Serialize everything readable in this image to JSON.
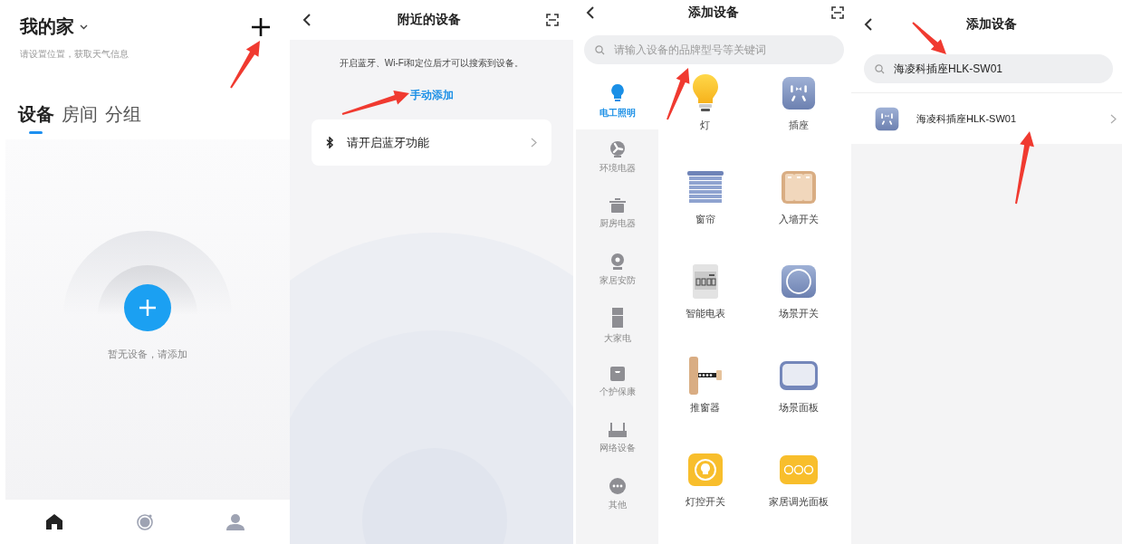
{
  "home": {
    "title": "我的家",
    "subtitle": "请设置位置，获取天气信息",
    "tabs": [
      {
        "label": "设备",
        "selected": true
      },
      {
        "label": "房间",
        "selected": false
      },
      {
        "label": "分组",
        "selected": false
      }
    ],
    "empty_text": "暂无设备，请添加",
    "nav": [
      {
        "kind": "home",
        "selected": true
      },
      {
        "kind": "devices",
        "selected": false
      },
      {
        "kind": "profile",
        "selected": false
      }
    ]
  },
  "nearby": {
    "title": "附近的设备",
    "hint": "开启蓝牙、Wi-Fi和定位后才可以搜索到设备。",
    "link": "手动添加",
    "bluetooth_row": "请开启蓝牙功能"
  },
  "add_device": {
    "title": "添加设备",
    "search": {
      "placeholder": "请输入设备的品牌型号等关键词"
    },
    "categories": [
      {
        "kind": "lighting",
        "label": "电工照明",
        "selected": true
      },
      {
        "kind": "fan",
        "label": "环境电器",
        "selected": false
      },
      {
        "kind": "pot",
        "label": "厨房电器",
        "selected": false
      },
      {
        "kind": "camera",
        "label": "家居安防",
        "selected": false
      },
      {
        "kind": "fridge",
        "label": "大家电",
        "selected": false
      },
      {
        "kind": "scale",
        "label": "个护保康",
        "selected": false
      },
      {
        "kind": "router",
        "label": "网络设备",
        "selected": false
      },
      {
        "kind": "more",
        "label": "其他",
        "selected": false
      }
    ],
    "devices": [
      {
        "kind": "bulb",
        "label": "灯"
      },
      {
        "kind": "socket",
        "label": "插座"
      },
      {
        "kind": "blinds",
        "label": "窗帘"
      },
      {
        "kind": "wall_switch",
        "label": "入墙开关"
      },
      {
        "kind": "meter",
        "label": "智能电表"
      },
      {
        "kind": "scene_switch",
        "label": "场景开关"
      },
      {
        "kind": "pusher",
        "label": "推窗器"
      },
      {
        "kind": "scene_panel",
        "label": "场景面板"
      },
      {
        "kind": "light_switch",
        "label": "灯控开关"
      },
      {
        "kind": "dimmer",
        "label": "家居调光面板"
      }
    ]
  },
  "search_result": {
    "title": "添加设备",
    "search": {
      "value": "海凌科插座HLK-SW01"
    },
    "results": [
      {
        "kind": "socket",
        "label": "海凌科插座HLK-SW01"
      }
    ]
  }
}
